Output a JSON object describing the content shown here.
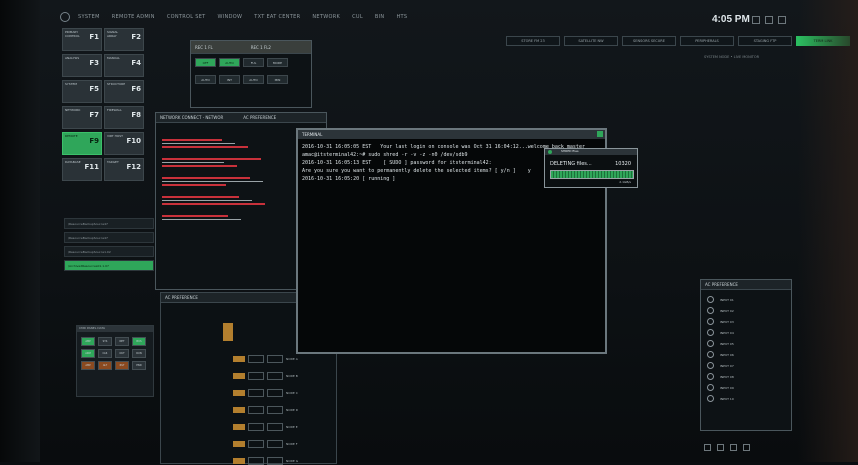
{
  "menu": [
    "SYSTEM",
    "REMOTE ADMIN",
    "CONTROL SET",
    "WINDOW",
    "TXT EAT CENTER",
    "NETWORK",
    "CUL",
    "BIN",
    "HTS"
  ],
  "clock": "4:05 PM",
  "tabs": [
    {
      "label": "STORE FM 23",
      "active": false
    },
    {
      "label": "SATELLITE NW",
      "active": false
    },
    {
      "label": "SENSORS SECURE",
      "active": false
    },
    {
      "label": "PERIPHERALS",
      "active": false
    },
    {
      "label": "STAGING FTP",
      "active": false
    },
    {
      "label": "TERM LINK",
      "active": true
    }
  ],
  "subinfo": "SYSTEM NODE • LIVE MONITOR",
  "fkeys": [
    {
      "label": "PRIMARY CONTROL",
      "key": "F1",
      "col": 0,
      "row": 0,
      "green": false
    },
    {
      "label": "SIGNAL ARRAY",
      "key": "F2",
      "col": 1,
      "row": 0,
      "green": false
    },
    {
      "label": "ANALYSIS",
      "key": "F3",
      "col": 0,
      "row": 1,
      "green": false
    },
    {
      "label": "MANUAL",
      "key": "F4",
      "col": 1,
      "row": 1,
      "green": false
    },
    {
      "label": "SYSTEM",
      "key": "F5",
      "col": 0,
      "row": 2,
      "green": false
    },
    {
      "label": "STRUCTURE",
      "key": "F6",
      "col": 1,
      "row": 2,
      "green": false
    },
    {
      "label": "NETWORK",
      "key": "F7",
      "col": 0,
      "row": 3,
      "green": false
    },
    {
      "label": "FIREWALL",
      "key": "F8",
      "col": 1,
      "row": 3,
      "green": false
    },
    {
      "label": "REMOTE",
      "key": "F9",
      "col": 0,
      "row": 4,
      "green": true
    },
    {
      "label": "VIRT HOST",
      "key": "F10",
      "col": 1,
      "row": 4,
      "green": false
    },
    {
      "label": "DATABASE",
      "key": "F11",
      "col": 0,
      "row": 5,
      "green": false
    },
    {
      "label": "TARGET",
      "key": "F12",
      "col": 1,
      "row": 5,
      "green": false
    }
  ],
  "sidelist": [
    {
      "label": "/ResourceBackupSource47",
      "on": false
    },
    {
      "label": "/ResourceBackupSource47",
      "on": false
    },
    {
      "label": "/ResourceBackupSource1.02",
      "on": false
    },
    {
      "label": "/ArchivedResources01.1.07",
      "on": true
    }
  ],
  "keypad": {
    "title": "CMD PANEL DATA",
    "keys": [
      {
        "l": "AMP",
        "c": "g"
      },
      {
        "l": "SYS",
        "c": ""
      },
      {
        "l": "NET",
        "c": ""
      },
      {
        "l": "BUS",
        "c": "g"
      },
      {
        "l": "ARM",
        "c": "g"
      },
      {
        "l": "CLR",
        "c": ""
      },
      {
        "l": "OUT",
        "c": ""
      },
      {
        "l": "RUN",
        "c": ""
      },
      {
        "l": "AMP",
        "c": "o"
      },
      {
        "l": "ALT",
        "c": "o"
      },
      {
        "l": "RST",
        "c": "o"
      },
      {
        "l": "END",
        "c": ""
      }
    ]
  },
  "recWindow": {
    "header1": "REC 1 FL",
    "header2": "REC 1 FL2",
    "buttons": [
      "OFF",
      "AUTO",
      "FUL",
      "MODE",
      "AUTO",
      "INT",
      "AUTO",
      "MIN"
    ]
  },
  "netWindow": {
    "title": "NETWORK CONNECT - NETWOR",
    "pref": "AC PREFERENCE"
  },
  "terminal": {
    "title": "TERMINAL",
    "lines": [
      "2016-10-31 16:05:05 EST   Your last login on console was Oct 31 16:04:12...welcome back master",
      "amac@itsterminal42:~# sudo shred -r -v -z -n0 /dev/sdb9",
      "2016-10-31 16:05:13 EST    [ SUDO ] password for itsterminal42:",
      "",
      "Are you sure you want to permanently delete the selected items? [ y/n ]    y",
      "2016-10-31 16:05:20 [ running ]"
    ]
  },
  "progress": {
    "title": "SHRED files",
    "label": "DELETING files...",
    "count": "10320",
    "rate": "2.1GB/s",
    "fraction": 1.0
  },
  "routing": {
    "title": "AC PREFERENCE",
    "rows": [
      "INPUT 01",
      "INPUT 02",
      "INPUT 03",
      "INPUT 04",
      "INPUT 05",
      "INPUT 06",
      "INPUT 07",
      "INPUT 08",
      "INPUT 09",
      "INPUT 10"
    ]
  },
  "tree": {
    "title": "AC PREFERENCE",
    "nodes": [
      "NODE A",
      "NODE B",
      "NODE C",
      "NODE D",
      "NODE E",
      "NODE F",
      "NODE G"
    ]
  }
}
